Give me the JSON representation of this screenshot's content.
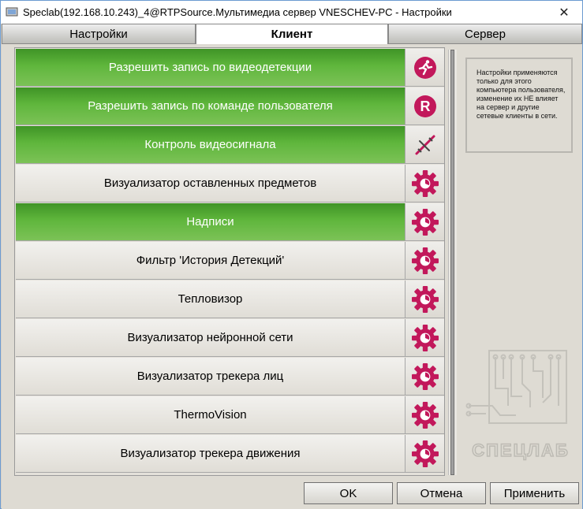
{
  "window": {
    "title": "Speclab(192.168.10.243)_4@RTPSource.Мультимедиа сервер VNESCHEV-PC - Настройки",
    "close_glyph": "✕"
  },
  "tabs": [
    {
      "label": "Настройки",
      "active": false
    },
    {
      "label": "Клиент",
      "active": true
    },
    {
      "label": "Сервер",
      "active": false
    }
  ],
  "items": [
    {
      "label": "Разрешить запись по видеодетекции",
      "enabled": true,
      "icon": "running-person-icon"
    },
    {
      "label": "Разрешить запись по команде пользователя",
      "enabled": true,
      "icon": "record-r-icon"
    },
    {
      "label": "Контроль видеосигнала",
      "enabled": true,
      "icon": "signal-broken-icon"
    },
    {
      "label": "Визуализатор оставленных предметов",
      "enabled": false,
      "icon": "gear-icon"
    },
    {
      "label": "Надписи",
      "enabled": true,
      "icon": "gear-icon"
    },
    {
      "label": "Фильтр 'История Детекций'",
      "enabled": false,
      "icon": "gear-icon"
    },
    {
      "label": "Тепловизор",
      "enabled": false,
      "icon": "gear-icon"
    },
    {
      "label": "Визуализатор нейронной сети",
      "enabled": false,
      "icon": "gear-icon"
    },
    {
      "label": "Визуализатор трекера лиц",
      "enabled": false,
      "icon": "gear-icon"
    },
    {
      "label": "ThermoVision",
      "enabled": false,
      "icon": "gear-icon"
    },
    {
      "label": "Визуализатор трекера движения",
      "enabled": false,
      "icon": "gear-icon"
    }
  ],
  "info_note": "Настройки применяются только для этого компьютера пользователя, изменение их НЕ влияет на сервер и другие сетевые клиенты в сети.",
  "logo_text": "СПЕЦЛАБ",
  "buttons": {
    "ok": "OK",
    "cancel": "Отмена",
    "apply": "Применить"
  },
  "colors": {
    "enabled_green": "#5fb63c",
    "icon_magenta": "#c2185b"
  }
}
